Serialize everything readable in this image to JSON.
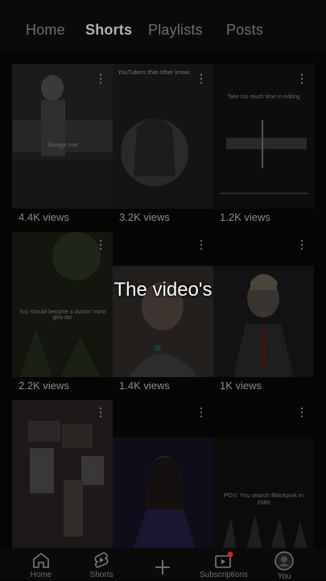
{
  "tabs": [
    {
      "label": "Home",
      "active": false
    },
    {
      "label": "Shorts",
      "active": true
    },
    {
      "label": "Playlists",
      "active": false
    },
    {
      "label": "Posts",
      "active": false
    }
  ],
  "shorts": [
    {
      "views": "4.4K views",
      "caption": "Savage one"
    },
    {
      "views": "3.2K views",
      "caption": "YouTubers that other know:"
    },
    {
      "views": "1.2K views",
      "caption": "Take too much time in editing"
    },
    {
      "views": "2.2K views",
      "caption": "You should become a doctor! most girls do!"
    },
    {
      "views": "1.4K views",
      "caption": ""
    },
    {
      "views": "1K views",
      "caption": ""
    },
    {
      "views": "",
      "caption": ""
    },
    {
      "views": "",
      "caption": ""
    },
    {
      "views": "",
      "caption": "POV: You search Blackpink in 2080"
    }
  ],
  "overlay_text": "The video's",
  "nav": [
    {
      "label": "Home",
      "icon": "home-icon"
    },
    {
      "label": "Shorts",
      "icon": "shorts-icon"
    },
    {
      "label": "",
      "icon": "create-icon"
    },
    {
      "label": "Subscriptions",
      "icon": "subscriptions-icon"
    },
    {
      "label": "You",
      "icon": "you-icon"
    }
  ],
  "colors": {
    "notification_dot": "#d0241c",
    "text_dim": "#8d8d8d"
  }
}
